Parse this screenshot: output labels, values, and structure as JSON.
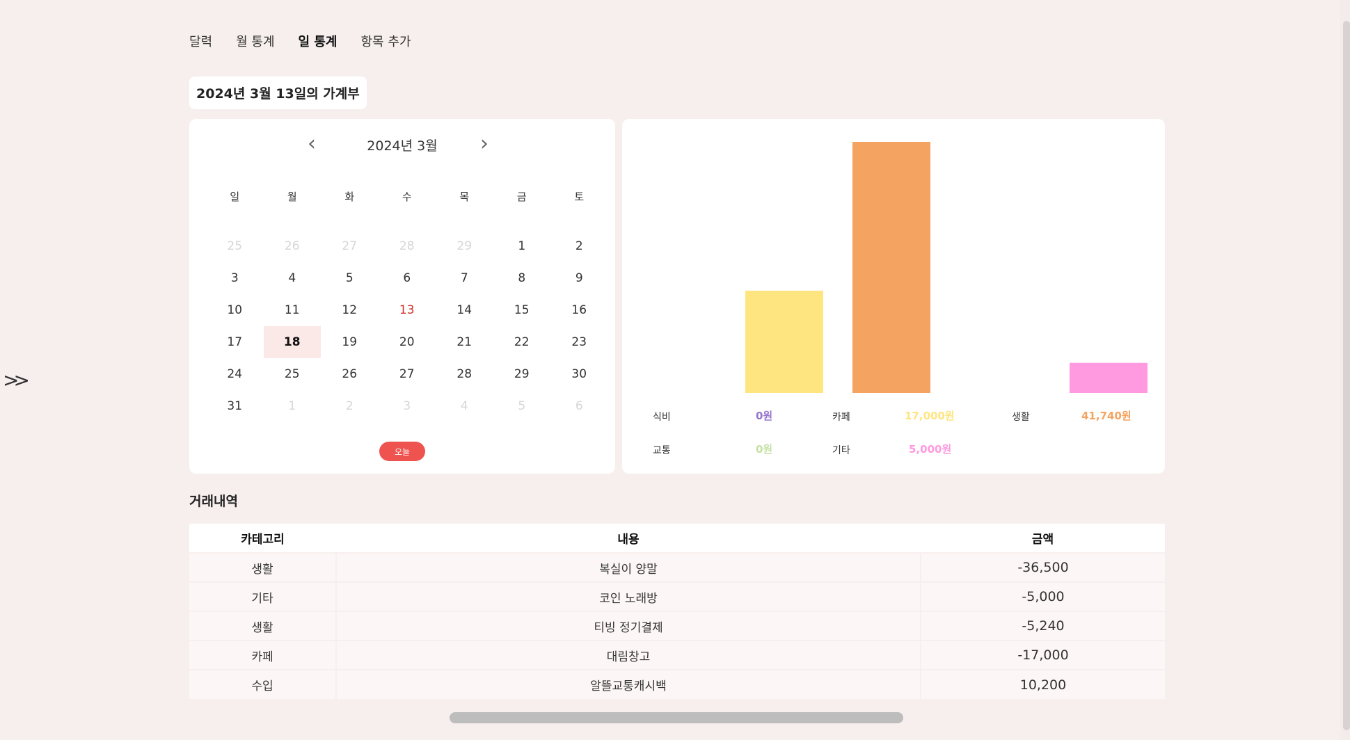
{
  "nav": {
    "items": [
      "달력",
      "월 통계",
      "일 통계",
      "항목 추가"
    ],
    "active": "일 통계"
  },
  "page_title": "2024년 3월 13일의 가계부",
  "sidebar_toggle": "»",
  "calendar": {
    "month_label": "2024년 3월",
    "prev": "‹",
    "next": "›",
    "weekdays": [
      "일",
      "월",
      "화",
      "수",
      "목",
      "금",
      "토"
    ],
    "weeks": [
      [
        "25",
        "26",
        "27",
        "28",
        "29",
        "1",
        "2"
      ],
      [
        "3",
        "4",
        "5",
        "6",
        "7",
        "8",
        "9"
      ],
      [
        "10",
        "11",
        "12",
        "13",
        "14",
        "15",
        "16"
      ],
      [
        "17",
        "18",
        "19",
        "20",
        "21",
        "22",
        "23"
      ],
      [
        "24",
        "25",
        "26",
        "27",
        "28",
        "29",
        "30"
      ],
      [
        "31",
        "1",
        "2",
        "3",
        "4",
        "5",
        "6"
      ]
    ],
    "today_button": "오늘"
  },
  "chart_data": {
    "type": "bar",
    "categories": [
      "식비",
      "카페",
      "생활",
      "교통",
      "기타"
    ],
    "values": [
      0,
      17000,
      41740,
      0,
      5000
    ],
    "colors": [
      "#b39ddb",
      "#ffe57f",
      "#f4a460",
      "#c5e1a5",
      "#ff99e0"
    ],
    "legend": [
      {
        "label": "식비",
        "value": "0원",
        "color": "#9575cd"
      },
      {
        "label": "카페",
        "value": "17,000원",
        "color": "#ffe57f"
      },
      {
        "label": "생활",
        "value": "41,740원",
        "color": "#f4a460"
      },
      {
        "label": "교통",
        "value": "0원",
        "color": "#c5e1a5"
      },
      {
        "label": "기타",
        "value": "5,000원",
        "color": "#ff99e0"
      }
    ]
  },
  "transactions": {
    "section_title": "거래내역",
    "headers": [
      "카테고리",
      "내용",
      "금액"
    ],
    "rows": [
      [
        "생활",
        "복실이 양말",
        "-36,500"
      ],
      [
        "기타",
        "코인 노래방",
        "-5,000"
      ],
      [
        "생활",
        "티빙 정기결제",
        "-5,240"
      ],
      [
        "카페",
        "대림창고",
        "-17,000"
      ],
      [
        "수입",
        "알뜰교통캐시백",
        "10,200"
      ]
    ]
  }
}
